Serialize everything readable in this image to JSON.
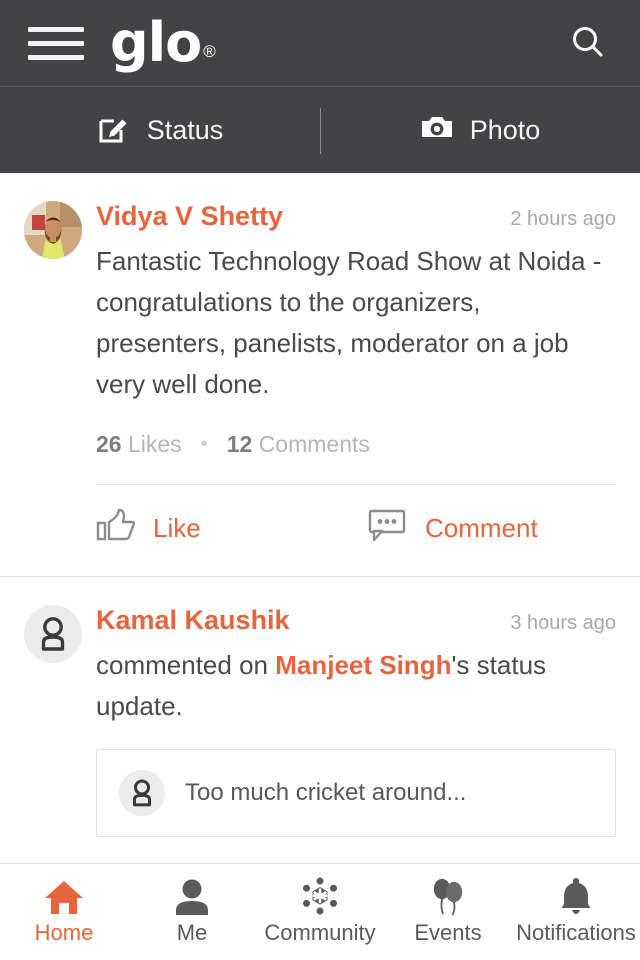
{
  "header": {
    "menu_icon": "hamburger-menu-icon",
    "logo_text": "glo",
    "logo_trademark": "®",
    "search_icon": "search-icon"
  },
  "compose_bar": {
    "tabs": [
      {
        "label": "Status",
        "icon": "compose-edit-icon"
      },
      {
        "label": "Photo",
        "icon": "camera-icon"
      }
    ]
  },
  "feed": {
    "posts": [
      {
        "author": "Vidya V Shetty",
        "timestamp": "2 hours ago",
        "avatar_type": "photo",
        "text": "Fantastic Technology Road Show at Noida - congratulations to the organizers, presenters, panelists, moderator on a job very well done.",
        "likes_count": "26",
        "likes_label": "Likes",
        "comments_count": "12",
        "comments_label": "Comments",
        "separator_dot": "•",
        "actions": [
          {
            "label": "Like",
            "icon": "thumbs-up-icon"
          },
          {
            "label": "Comment",
            "icon": "comment-bubble-icon"
          }
        ]
      },
      {
        "author": "Kamal Kaushik",
        "timestamp": "3 hours ago",
        "avatar_type": "placeholder",
        "text_before": "commented on ",
        "mention": "Manjeet Singh",
        "text_after": "'s status update.",
        "quote": {
          "avatar_type": "placeholder",
          "text": "Too much cricket around..."
        }
      }
    ]
  },
  "bottom_nav": {
    "items": [
      {
        "label": "Home",
        "icon": "home-icon",
        "active": true
      },
      {
        "label": "Me",
        "icon": "person-icon",
        "active": false
      },
      {
        "label": "Community",
        "icon": "network-hub-icon",
        "active": false
      },
      {
        "label": "Events",
        "icon": "balloons-icon",
        "active": false
      },
      {
        "label": "Notifications",
        "icon": "bell-icon",
        "active": false
      }
    ]
  },
  "colors": {
    "accent": "#e8643c",
    "header_bg": "#434345",
    "body_text": "#4a4a4a",
    "muted_text": "#a8a8a8",
    "icon_gray": "#5a5a5a",
    "divider": "#e2e2e2"
  }
}
